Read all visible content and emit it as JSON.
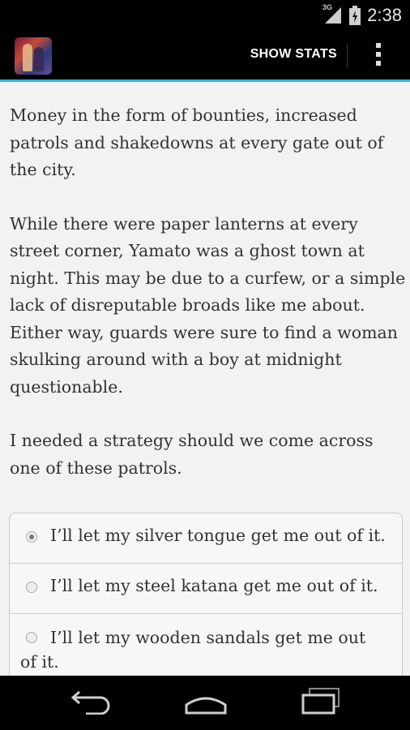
{
  "status_bar": {
    "network": "3G",
    "time": "2:38"
  },
  "action_bar": {
    "app_icon": "app-icon",
    "show_stats_label": "SHOW STATS",
    "overflow_icon": "overflow-menu-icon"
  },
  "story": {
    "paragraphs": [
      "Money in the form of bounties, increased patrols and shakedowns at every gate out of the city.",
      "While there were paper lanterns at every street corner, Yamato was a ghost town at night. This may be due to a curfew, or a simple lack of disreputable broads like me about. Either way, guards were sure to find a woman skulking around with a boy at midnight questionable.",
      "I needed a strategy should we come across one of these patrols."
    ]
  },
  "choices": [
    {
      "label": "I’ll let my silver tongue get me out of it.",
      "selected": true
    },
    {
      "label": "I’ll let my steel katana get me out of it.",
      "selected": false
    },
    {
      "label": "I’ll let my wooden sandals get me out of it.",
      "selected": false
    }
  ],
  "nav_bar": {
    "icons": [
      "back-icon",
      "home-icon",
      "recent-apps-icon"
    ]
  },
  "colors": {
    "accent": "#33b5e5",
    "bars": "#000000",
    "page_background": "#f2f2f2",
    "text": "#333333"
  }
}
